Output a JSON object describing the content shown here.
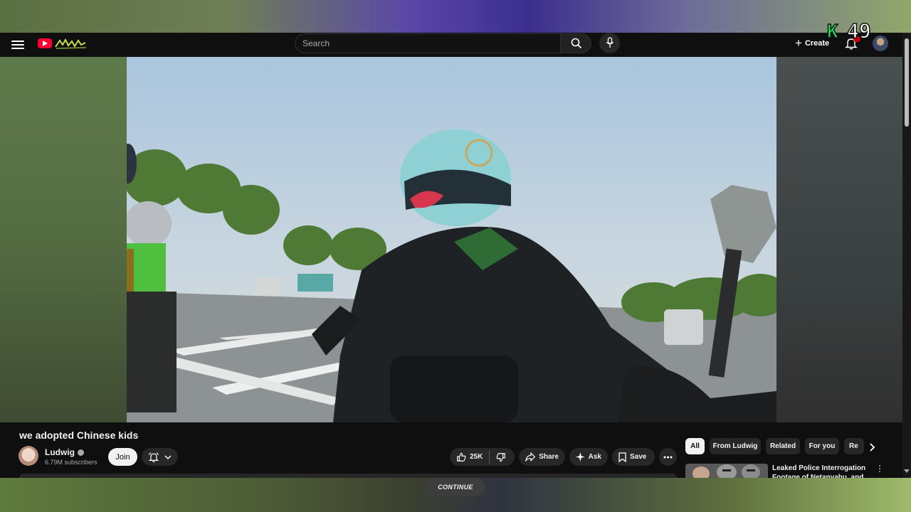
{
  "masthead": {
    "search_placeholder": "Search",
    "create_label": "Create"
  },
  "overlay": {
    "k": "K",
    "number": "49"
  },
  "video": {
    "title": "we adopted Chinese kids"
  },
  "channel": {
    "name": "Ludwig",
    "subscribers": "6.79M subscribers",
    "join_label": "Join"
  },
  "actions": {
    "likes": "25K",
    "share": "Share",
    "ask": "Ask",
    "save": "Save"
  },
  "chips": [
    "All",
    "From Ludwig",
    "Related",
    "For you",
    "Re"
  ],
  "recommendation": {
    "title": "Leaked Police Interrogation Footage of Netanyahu, and Ho"
  },
  "continue_label": "CONTINUE",
  "colors": {
    "yt_bg": "#0f0f0f",
    "yt_red": "#ff0033",
    "pill_bg": "#272727",
    "overlay_green": "#22e35a"
  },
  "icons": [
    "menu-icon",
    "youtube-logo-icon",
    "search-icon",
    "mic-icon",
    "plus-icon",
    "bell-icon",
    "thumbs-up-icon",
    "thumbs-down-icon",
    "share-icon",
    "sparkle-icon",
    "bookmark-icon",
    "more-icon",
    "chevron-right-icon",
    "chevron-down-icon",
    "verified-icon"
  ]
}
